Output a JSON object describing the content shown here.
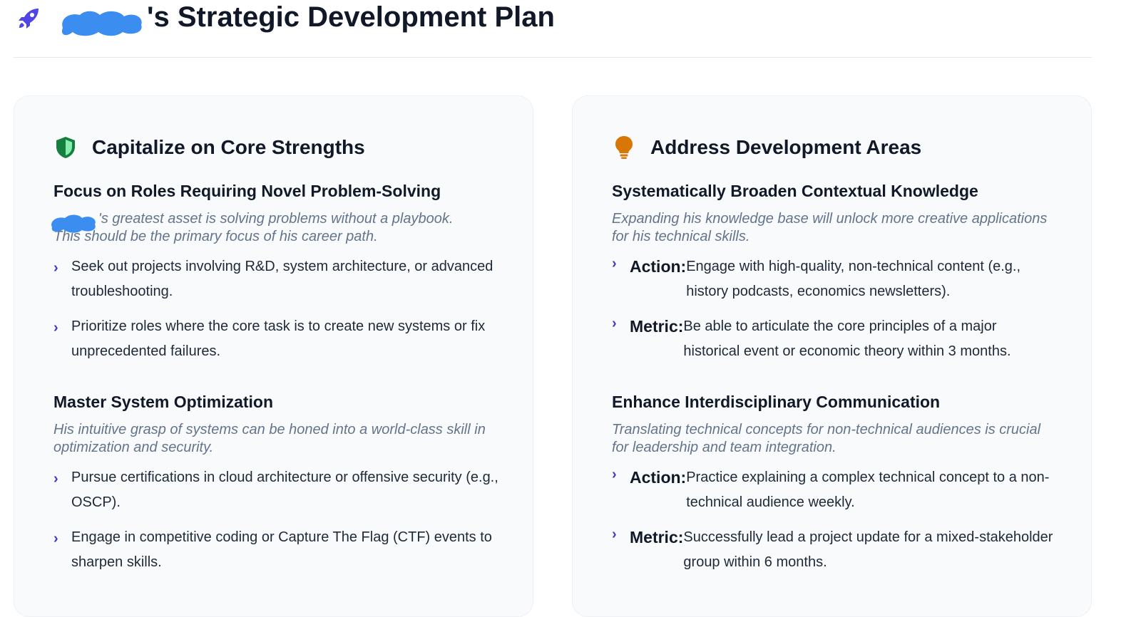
{
  "header": {
    "title_suffix": "'s Strategic Development Plan",
    "icon": "rocket-icon",
    "accent": "#4f46e5"
  },
  "strengths": {
    "title": "Capitalize on Core Strengths",
    "icon": "shield-icon",
    "icon_color": "#15803d",
    "sections": [
      {
        "title": "Focus on Roles Requiring Novel Problem-Solving",
        "desc_part1": "'s greatest asset is solving problems without a playbook.",
        "desc_part2": "This should be the primary focus of his career path.",
        "bullets": [
          "Seek out projects involving R&D, system architecture, or advanced troubleshooting.",
          "Prioritize roles where the core task is to create new systems or fix unprecedented failures."
        ]
      },
      {
        "title": "Master System Optimization",
        "desc": "His intuitive grasp of systems can be honed into a world-class skill in optimization and security.",
        "bullets": [
          "Pursue certifications in cloud architecture or offensive security (e.g., OSCP).",
          "Engage in competitive coding or Capture The Flag (CTF) events to sharpen skills."
        ]
      }
    ]
  },
  "development": {
    "title": "Address Development Areas",
    "icon": "lightbulb-icon",
    "icon_color": "#d97706",
    "sections": [
      {
        "title": "Systematically Broaden Contextual Knowledge",
        "desc": "Expanding his knowledge base will unlock more creative applications for his technical skills.",
        "action_label": "Action:",
        "action_text": "Engage with high-quality, non-technical content (e.g., history podcasts, economics newsletters).",
        "metric_label": "Metric:",
        "metric_text": "Be able to articulate the core principles of a major historical event or economic theory within 3 months."
      },
      {
        "title": "Enhance Interdisciplinary Communication",
        "desc": "Translating technical concepts for non-technical audiences is crucial for leadership and team integration.",
        "action_label": "Action:",
        "action_text": "Practice explaining a complex technical concept to a non-technical audience weekly.",
        "metric_label": "Metric:",
        "metric_text": "Successfully lead a project update for a mixed-stakeholder group within 6 months."
      }
    ]
  },
  "chevron": "›"
}
